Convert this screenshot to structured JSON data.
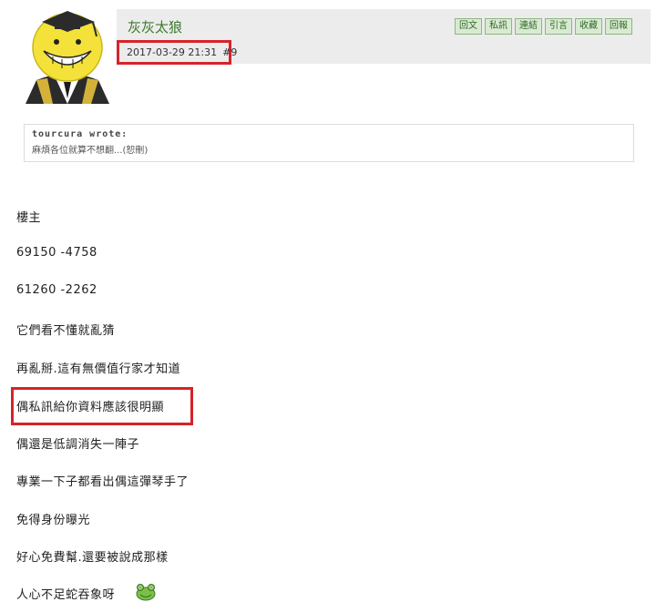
{
  "post": {
    "author": "灰灰太狼",
    "date": "2017-03-29 21:31",
    "floor": "#9"
  },
  "actions": [
    "回文",
    "私訊",
    "連結",
    "引言",
    "收藏",
    "回報"
  ],
  "quote": {
    "author": "tourcura wrote:",
    "text": "麻煩各位就算不想翻...(恕刪)"
  },
  "body_lines": [
    "樓主",
    "69150 -4758",
    "61260 -2262",
    "它們看不懂就亂猜",
    "再亂掰.這有無價值行家才知道",
    "偶私訊給你資料應該很明顯",
    "偶還是低調消失一陣子",
    "專業一下子都看出偶這彈琴手了",
    "免得身份曝光",
    "好心免費幫.還要被說成那樣",
    "人心不足蛇吞象呀"
  ],
  "colors": {
    "author_green": "#3d7a2a",
    "highlight_red": "#d6232a",
    "header_bg": "#ececec"
  },
  "icons": {
    "avatar": "graduate-smiley-avatar",
    "emoji": "green-frog-emoji-icon"
  }
}
